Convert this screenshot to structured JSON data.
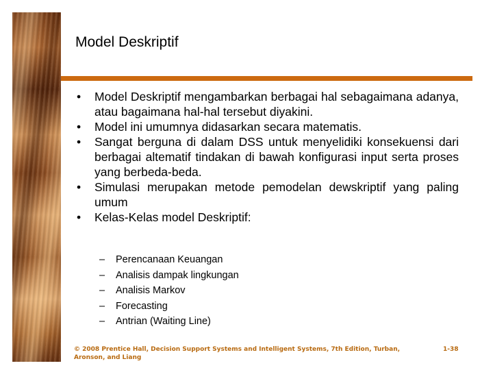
{
  "slide": {
    "title": "Model Deskriptif",
    "bullets": [
      "Model Deskriptif mengambarkan berbagai hal sebagaimana adanya, atau bagaimana hal-hal tersebut diyakini.",
      "Model ini umumnya didasarkan secara matematis.",
      "Sangat berguna di dalam DSS untuk menyelidiki konsekuensi dari berbagai altematif tindakan di bawah konfigurasi input serta proses yang berbeda-beda.",
      "Simulasi merupakan metode pemodelan dewskriptif yang paling umum",
      "Kelas-Kelas model Deskriptif:"
    ],
    "bullet_glyph": "•",
    "sub_bullet_glyph": "–",
    "sub_bullets": [
      "Perencanaan Keuangan",
      "Analisis dampak lingkungan",
      "Analisis Markov",
      "Forecasting",
      "Antrian (Waiting Line)"
    ],
    "footer": "© 2008  Prentice Hall, Decision Support Systems and Intelligent Systems, 7th Edition, Turban, Aronson, and Liang",
    "page_number": "1-38",
    "colors": {
      "accent": "#cc6a10",
      "footer_text": "#b86a10"
    }
  }
}
